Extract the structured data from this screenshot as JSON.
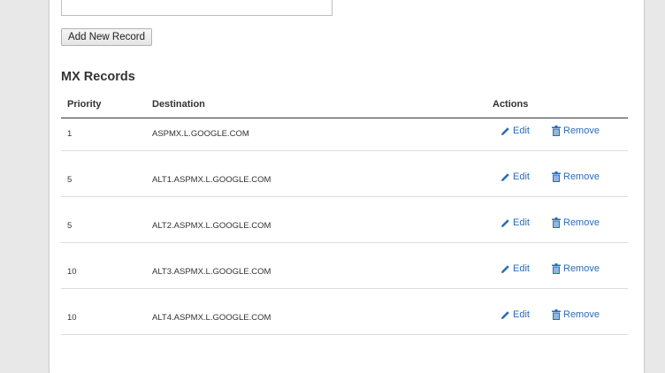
{
  "form": {
    "add_record_label": "Add New Record"
  },
  "section": {
    "title": "MX Records"
  },
  "table": {
    "headers": {
      "priority": "Priority",
      "destination": "Destination",
      "actions": "Actions"
    },
    "rows": [
      {
        "priority": "1",
        "destination": "ASPMX.L.GOOGLE.COM"
      },
      {
        "priority": "5",
        "destination": "ALT1.ASPMX.L.GOOGLE.COM"
      },
      {
        "priority": "5",
        "destination": "ALT2.ASPMX.L.GOOGLE.COM"
      },
      {
        "priority": "10",
        "destination": "ALT3.ASPMX.L.GOOGLE.COM"
      },
      {
        "priority": "10",
        "destination": "ALT4.ASPMX.L.GOOGLE.COM"
      }
    ],
    "edit_label": "Edit",
    "remove_label": "Remove",
    "edit_icon": "pencil-icon",
    "remove_icon": "trash-icon"
  },
  "colors": {
    "link": "#2a6db7",
    "text": "#333333",
    "page_background": "#e8e8e8"
  }
}
